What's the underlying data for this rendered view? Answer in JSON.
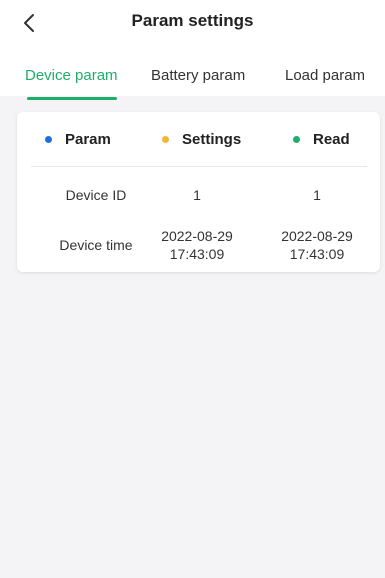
{
  "header": {
    "title": "Param settings",
    "back_icon": "chevron-left-icon"
  },
  "tabs": [
    {
      "label": "Device param",
      "active": true
    },
    {
      "label": "Battery param",
      "active": false
    },
    {
      "label": "Load param",
      "active": false
    }
  ],
  "table": {
    "columns": [
      {
        "label": "Param",
        "dot_color": "#1e6fdc"
      },
      {
        "label": "Settings",
        "dot_color": "#f2b632"
      },
      {
        "label": "Read",
        "dot_color": "#1fae6a"
      }
    ],
    "rows": [
      {
        "param": "Device ID",
        "settings": [
          "1"
        ],
        "read": [
          "1"
        ]
      },
      {
        "param": "Device time",
        "settings": [
          "2022-08-29",
          "17:43:09"
        ],
        "read": [
          "2022-08-29",
          "17:43:09"
        ]
      }
    ]
  },
  "colors": {
    "accent": "#1fae6a",
    "background": "#f4f4f6"
  }
}
